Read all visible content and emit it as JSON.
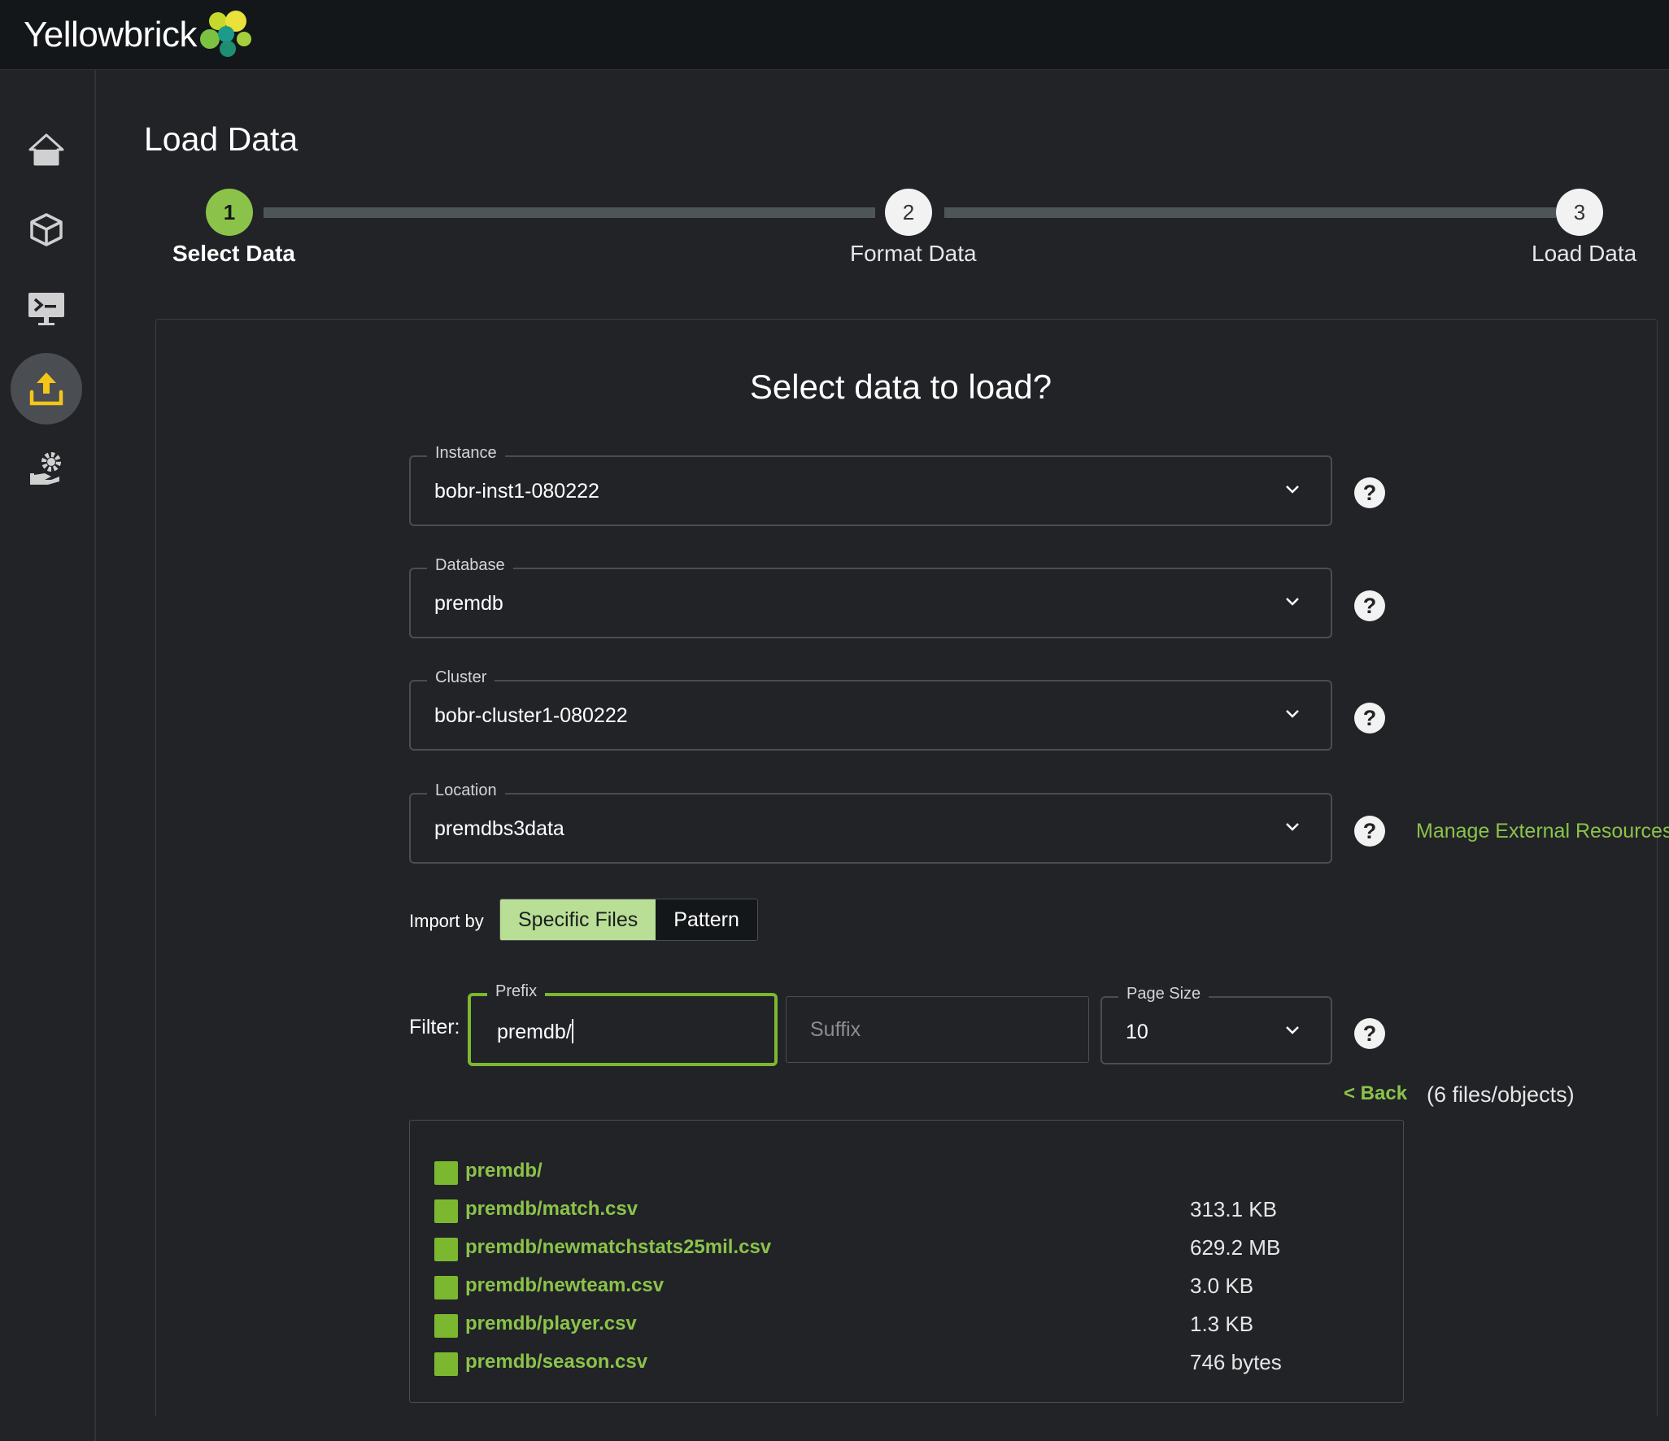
{
  "app": {
    "brand": "Yellowbrick"
  },
  "sidebar": {
    "items": [
      {
        "icon": "home-icon"
      },
      {
        "icon": "cube-icon"
      },
      {
        "icon": "terminal-icon"
      },
      {
        "icon": "upload-icon",
        "active": true
      },
      {
        "icon": "user-settings-icon"
      }
    ]
  },
  "page": {
    "title": "Load Data"
  },
  "stepper": {
    "steps": [
      {
        "number": "1",
        "label": "Select Data",
        "state": "done"
      },
      {
        "number": "2",
        "label": "Format Data",
        "state": "todo"
      },
      {
        "number": "3",
        "label": "Load Data",
        "state": "todo"
      }
    ]
  },
  "form": {
    "title": "Select data to load?",
    "instance": {
      "label": "Instance",
      "value": "bobr-inst1-080222"
    },
    "database": {
      "label": "Database",
      "value": "premdb"
    },
    "cluster": {
      "label": "Cluster",
      "value": "bobr-cluster1-080222"
    },
    "location": {
      "label": "Location",
      "value": "premdbs3data"
    },
    "manage_link": "Manage External Resources",
    "import_by": {
      "label": "Import by",
      "options": [
        "Specific Files",
        "Pattern"
      ],
      "selected": "Specific Files"
    },
    "filter": {
      "label": "Filter:",
      "prefix_label": "Prefix",
      "prefix_value": "premdb/",
      "suffix_placeholder": "Suffix",
      "page_size_label": "Page Size",
      "page_size_value": "10"
    },
    "back_link": "< Back",
    "count": "(6 files/objects)",
    "files": [
      {
        "name": "premdb/",
        "size": ""
      },
      {
        "name": "premdb/match.csv",
        "size": "313.1 KB"
      },
      {
        "name": "premdb/newmatchstats25mil.csv",
        "size": "629.2 MB"
      },
      {
        "name": "premdb/newteam.csv",
        "size": "3.0 KB"
      },
      {
        "name": "premdb/player.csv",
        "size": "1.3 KB"
      },
      {
        "name": "premdb/season.csv",
        "size": "746 bytes"
      }
    ]
  },
  "colors": {
    "accent": "#8bc34a",
    "background": "#212327",
    "topbar": "#13171a"
  }
}
